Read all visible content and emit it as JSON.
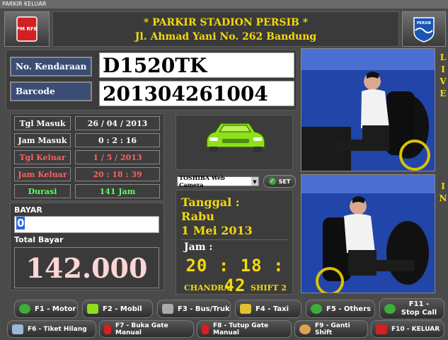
{
  "window": {
    "title": "PARKIR KELUAR"
  },
  "header": {
    "line1": "* PARKIR STADION  PERSIB *",
    "line2": "Jl. Ahmad Yani No. 262 Bandung"
  },
  "logo_left_text": "PM RFB",
  "logo_right_text": "PERSIB",
  "vehicle": {
    "plate_label": "No. Kendaraan",
    "plate_value": "D1520TK",
    "barcode_label": "Barcode",
    "barcode_value": "201304261004"
  },
  "times": {
    "tgl_masuk_label": "Tgl Masuk",
    "tgl_masuk_value": "26 / 04 / 2013",
    "jam_masuk_label": "Jam Masuk",
    "jam_masuk_value": "0 : 2 : 16",
    "tgl_keluar_label": "Tgl Keluar",
    "tgl_keluar_value": "1 / 5 / 2013",
    "jam_keluar_label": "Jam Keluar",
    "jam_keluar_value": "20 : 18 : 39",
    "durasi_label": "Durasi",
    "durasi_value": "141 Jam"
  },
  "payment": {
    "bayar_label": "BAYAR",
    "bayar_value": "0",
    "total_label": "Total Bayar",
    "total_value": "142.000"
  },
  "camera": {
    "select_value": "TOSHIBA Web Camera",
    "set_label": "SET"
  },
  "clock": {
    "tanggal_label": "Tanggal :",
    "day": "Rabu",
    "date": "1 Mei 2013",
    "jam_label": "Jam :",
    "time": "20 : 18 : 42",
    "operator": "CHANDRA",
    "shift": "SHIFT 2"
  },
  "side_labels": {
    "live": "LIVE",
    "in": "IN"
  },
  "buttons_row1": [
    {
      "label": "F1 - Motor"
    },
    {
      "label": "F2 - Mobil"
    },
    {
      "label": "F3 - Bus/Truk"
    },
    {
      "label": "F4 - Taxi"
    },
    {
      "label": "F5 - Others"
    },
    {
      "label": "F11 - Stop Call"
    }
  ],
  "buttons_row2": [
    {
      "label": "F6 - Tiket Hilang"
    },
    {
      "label": "F7 - Buka Gate Manual"
    },
    {
      "label": "F8 - Tutup Gate Manual"
    },
    {
      "label": "F9 - Ganti Shift"
    },
    {
      "label": "F10 - KELUAR"
    }
  ],
  "colors": {
    "accent_yellow": "#f5d90a",
    "label_blue": "#3b4d75",
    "keluar_red": "#ff6060",
    "durasi_green": "#5cff5c",
    "total_red": "#ffd5d5"
  }
}
